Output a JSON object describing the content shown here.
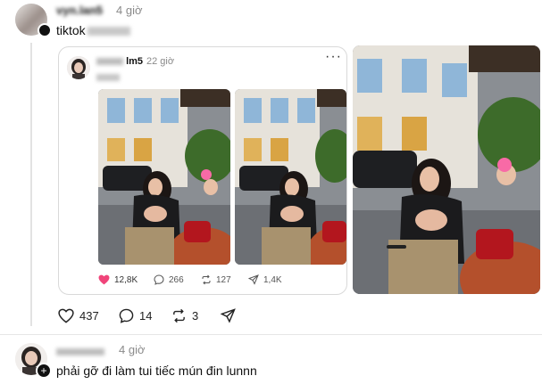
{
  "post": {
    "username_visible": "vyn.lan5",
    "time": "4 giờ",
    "text": "tiktok"
  },
  "quoted": {
    "username_visible": "lm5",
    "time": "22 giờ",
    "stats": {
      "likes": "12,8K",
      "comments": "266",
      "reposts": "127",
      "shares": "1,4K"
    }
  },
  "actions": {
    "likes": "437",
    "comments": "14",
    "reposts": "3"
  },
  "reply": {
    "username_visible": "m...",
    "time": "4 giờ",
    "text": "phải gỡ đi làm tui tiếc mún đin lunnn"
  },
  "colors": {
    "heart": "#f0447a",
    "border": "#d9d9d9",
    "line": "#e2e2e2"
  },
  "icons": [
    "heart-icon",
    "comment-icon",
    "repost-icon",
    "share-icon",
    "more-icon",
    "follow-plus-icon"
  ]
}
